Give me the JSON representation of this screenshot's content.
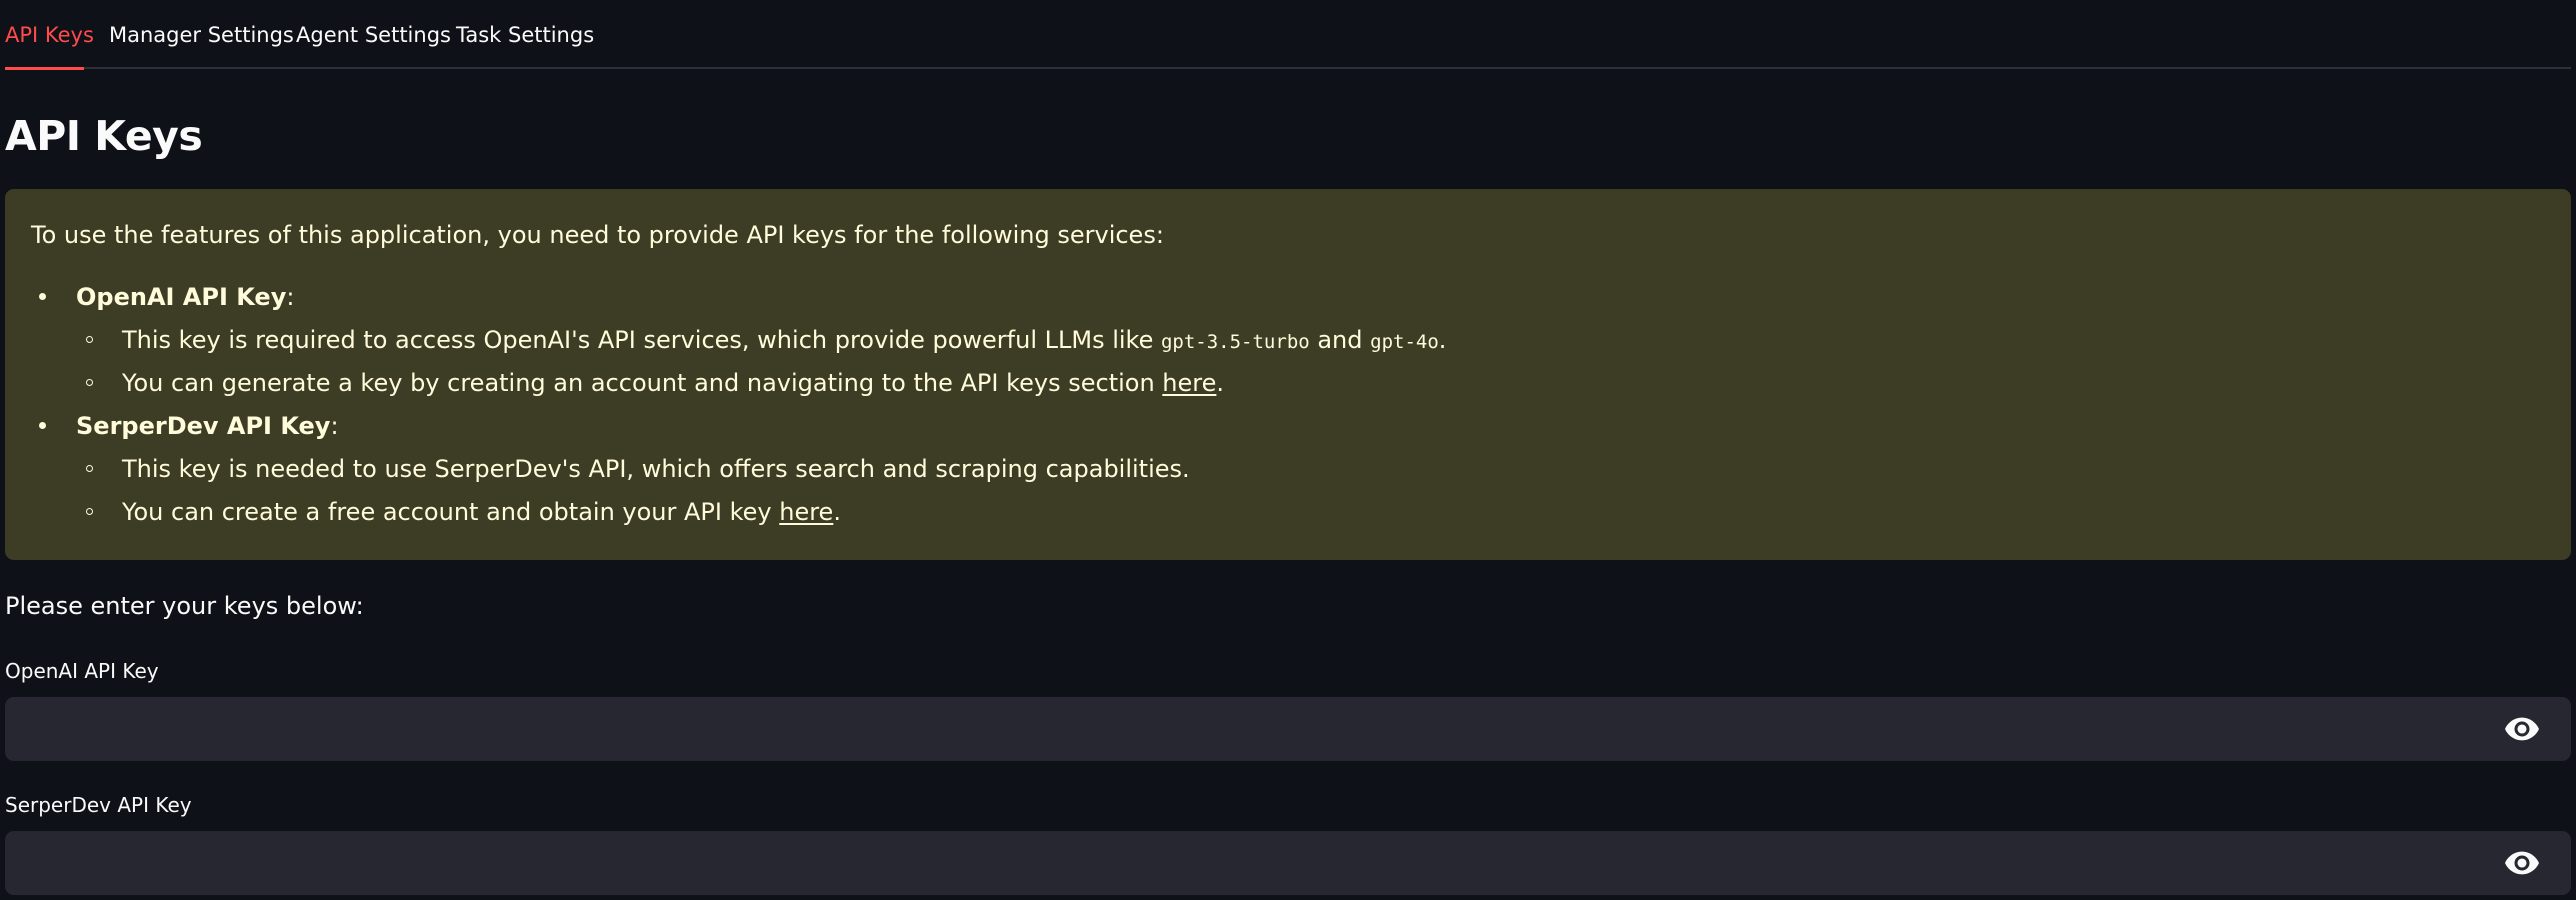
{
  "tabs": [
    {
      "label": "API Keys",
      "active": true
    },
    {
      "label": "Manager Settings",
      "active": false
    },
    {
      "label": "Agent Settings",
      "active": false
    },
    {
      "label": "Task Settings",
      "active": false
    }
  ],
  "page_title": "API Keys",
  "info": {
    "intro": "To use the features of this application, you need to provide API keys for the following services:",
    "openai": {
      "title": "OpenAI API Key",
      "colon": ":",
      "line1_prefix": "This key is required to access OpenAI's API services, which provide powerful LLMs like ",
      "code1": "gpt-3.5-turbo",
      "line1_and": " and ",
      "code2": "gpt-4o",
      "line1_suffix": ".",
      "line2_prefix": "You can generate a key by creating an account and navigating to the API keys section ",
      "line2_link": "here",
      "line2_suffix": "."
    },
    "serper": {
      "title": "SerperDev API Key",
      "colon": ":",
      "line1": "This key is needed to use SerperDev's API, which offers search and scraping capabilities.",
      "line2_prefix": "You can create a free account and obtain your API key ",
      "line2_link": "here",
      "line2_suffix": "."
    }
  },
  "form": {
    "prompt": "Please enter your keys below:",
    "openai_label": "OpenAI API Key",
    "openai_value": "",
    "serper_label": "SerperDev API Key",
    "serper_value": ""
  },
  "icons": {
    "password_toggle": "eye-icon"
  },
  "colors": {
    "accent": "#ff4b4b",
    "background": "#0e1117",
    "info_background": "#3d3d25",
    "info_text": "#fffbdb",
    "input_background": "#262730"
  }
}
